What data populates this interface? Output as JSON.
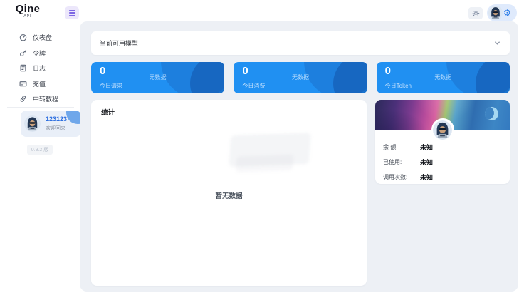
{
  "brand": {
    "name": "Qine",
    "tagline": "— API —"
  },
  "sidebar": {
    "items": [
      {
        "label": "仪表盘",
        "icon": "dashboard-gauge-icon"
      },
      {
        "label": "令牌",
        "icon": "key-icon"
      },
      {
        "label": "日志",
        "icon": "log-file-icon"
      },
      {
        "label": "充值",
        "icon": "credit-card-icon"
      },
      {
        "label": "中转教程",
        "icon": "link-icon"
      }
    ],
    "user": {
      "name": "123123",
      "greeting": "欢迎回来"
    },
    "version": "0.9.2 版"
  },
  "main": {
    "model_bar": {
      "label": "当前可用模型"
    },
    "stat_cards": [
      {
        "value": "0",
        "label": "今日请求",
        "empty": "无数据"
      },
      {
        "value": "0",
        "label": "今日消费",
        "empty": "无数据"
      },
      {
        "value": "0",
        "label": "今日Token",
        "empty": "无数据"
      }
    ],
    "stats_panel": {
      "title": "统计",
      "empty": "暂无数据"
    },
    "account_card": {
      "rows": [
        {
          "label": "余 额:",
          "value": "未知"
        },
        {
          "label": "已使用:",
          "value": "未知"
        },
        {
          "label": "调用次数:",
          "value": "未知"
        }
      ]
    }
  },
  "icons": {
    "settings": "⚙"
  },
  "colors": {
    "primary_blue": "#2080f0",
    "stat_card_blue": "#2090f2",
    "panel_bg": "#edf0f5",
    "hamburger_bg": "#ece7fb",
    "hamburger_fg": "#7d66e3",
    "user_card_bg": "#e9eff8"
  }
}
